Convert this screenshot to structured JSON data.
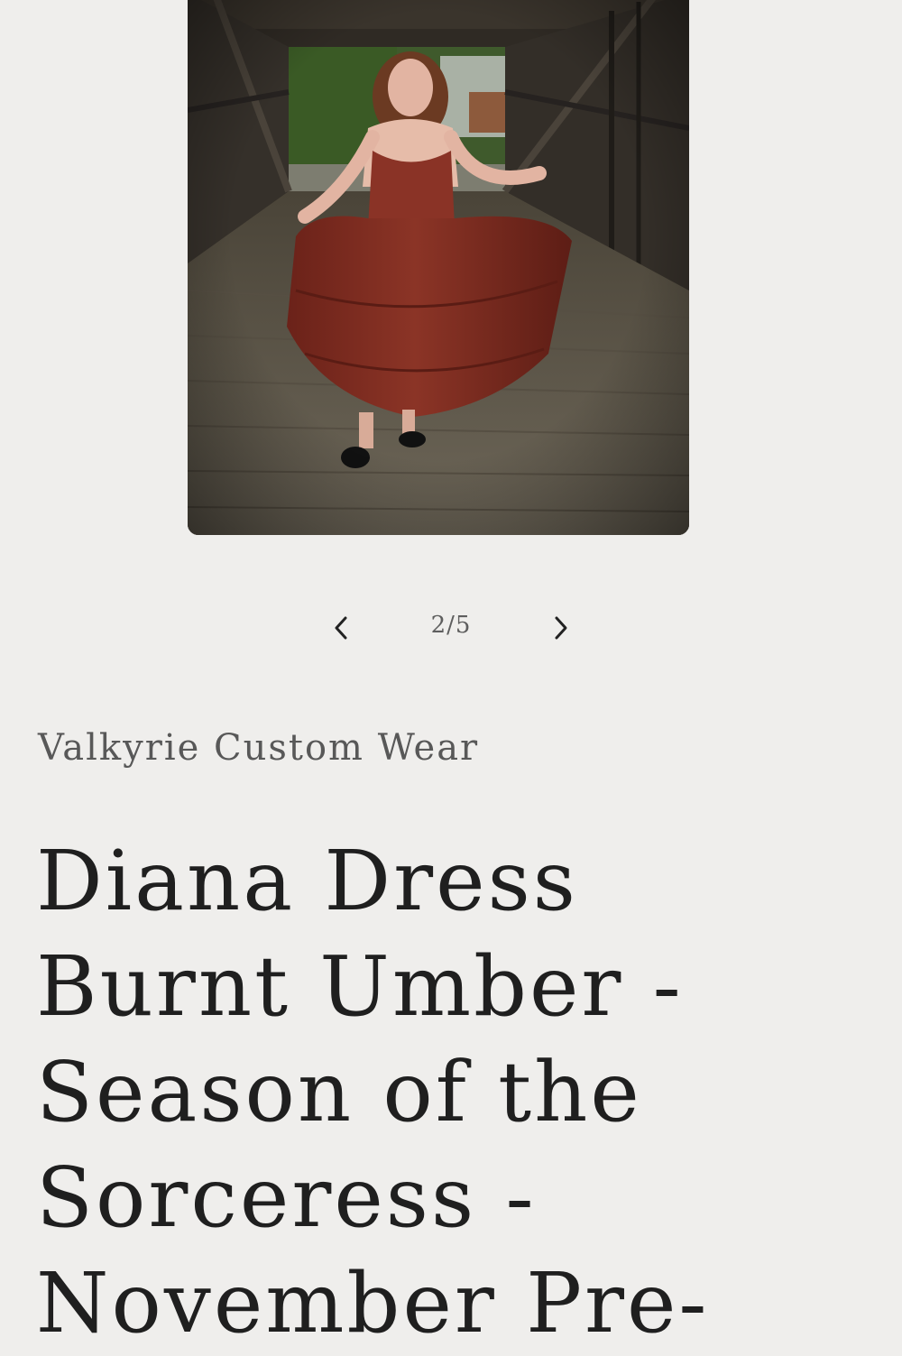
{
  "product": {
    "image_alt": "Model wearing a burnt umber tiered dress in a wooden covered bridge",
    "slider": {
      "counter": "2/5",
      "current": 2,
      "total": 5,
      "prev_icon": "chevron-left-icon",
      "next_icon": "chevron-right-icon"
    },
    "vendor": "Valkyrie Custom Wear",
    "title": "Diana Dress Burnt Umber - Season of the Sorceress - November Pre-"
  },
  "colors": {
    "background": "#efeeec",
    "title_text": "#1f1f1f",
    "vendor_text": "#585858",
    "dress": "#7a2a1f"
  }
}
